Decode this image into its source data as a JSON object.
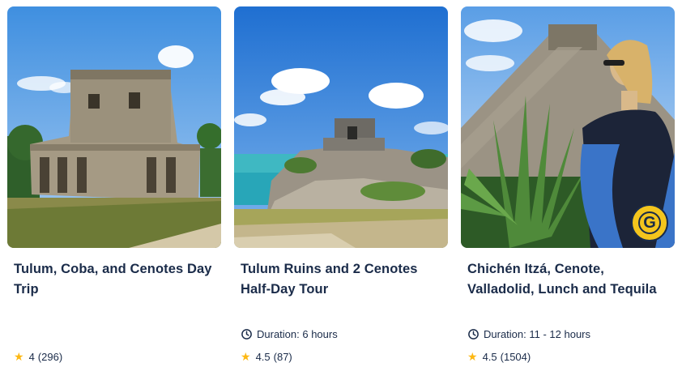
{
  "cards": [
    {
      "title": "Tulum, Coba, and Cenotes Day Trip",
      "duration_label": "",
      "rating": "4",
      "review_count": "(296)",
      "image_icon": "mayan-ruin-photo"
    },
    {
      "title": "Tulum Ruins and 2 Cenotes Half-Day Tour",
      "duration_label": "Duration: 6 hours",
      "rating": "4.5",
      "review_count": "(87)",
      "image_icon": "tulum-coast-photo"
    },
    {
      "title": "Chichén Itzá, Cenote, Valladolid, Lunch and Tequila",
      "duration_label": "Duration: 11 - 12 hours",
      "rating": "4.5",
      "review_count": "(1504)",
      "image_icon": "chichen-itza-photo",
      "badge_letter": "G"
    }
  ],
  "colors": {
    "text": "#1a2b49",
    "star": "#fdb813",
    "badge": "#f4c51d"
  }
}
